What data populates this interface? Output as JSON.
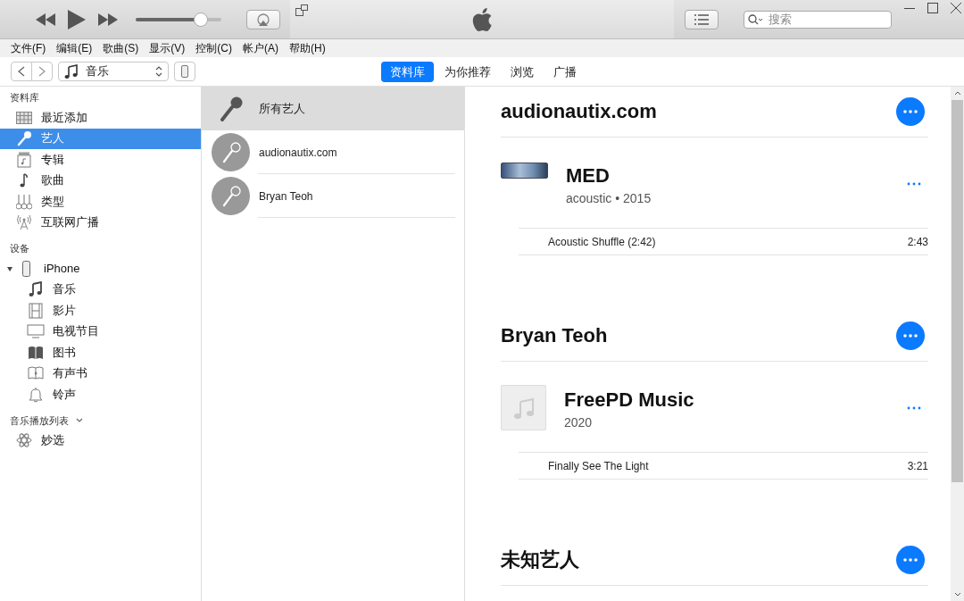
{
  "player": {
    "volume": {
      "level": 0.76
    }
  },
  "search": {
    "placeholder": "搜索"
  },
  "menu": [
    "文件(F)",
    "编辑(E)",
    "歌曲(S)",
    "显示(V)",
    "控制(C)",
    "帐户(A)",
    "帮助(H)"
  ],
  "media_picker": {
    "value": "音乐"
  },
  "tabs": [
    {
      "label": "资料库",
      "selected": true
    },
    {
      "label": "为你推荐",
      "selected": false
    },
    {
      "label": "浏览",
      "selected": false
    },
    {
      "label": "广播",
      "selected": false
    }
  ],
  "sidebar": {
    "library": {
      "heading": "资料库",
      "items": [
        {
          "label": "最近添加",
          "selected": false
        },
        {
          "label": "艺人",
          "selected": true
        },
        {
          "label": "专辑",
          "selected": false
        },
        {
          "label": "歌曲",
          "selected": false
        },
        {
          "label": "类型",
          "selected": false
        },
        {
          "label": "互联网广播",
          "selected": false
        }
      ]
    },
    "devices": {
      "heading": "设备",
      "items": [
        {
          "label": "iPhone",
          "expanded": true,
          "children": [
            {
              "label": "音乐",
              "selected": false
            },
            {
              "label": "影片",
              "selected": false
            },
            {
              "label": "电视节目",
              "selected": false
            },
            {
              "label": "图书",
              "selected": false
            },
            {
              "label": "有声书",
              "selected": false
            },
            {
              "label": "铃声",
              "selected": false
            }
          ]
        }
      ]
    },
    "playlists": {
      "heading": "音乐播放列表",
      "items": [
        {
          "label": "妙选",
          "selected": false
        }
      ]
    }
  },
  "artists": [
    {
      "kind": "all",
      "name": "所有艺人",
      "selected": true
    },
    {
      "kind": "artist",
      "name": "audionautix.com",
      "selected": false
    },
    {
      "kind": "artist",
      "name": "Bryan Teoh",
      "selected": false
    }
  ],
  "detail": [
    {
      "artist": "audionautix.com",
      "albums": [
        {
          "kind": "photo",
          "title": "MED",
          "subtitle": "acoustic • 2015",
          "tracks": [
            {
              "title": "Acoustic Shuffle (2:42)",
              "duration": "2:43"
            }
          ]
        }
      ]
    },
    {
      "artist": "Bryan Teoh",
      "albums": [
        {
          "kind": "placeholder",
          "title": "FreePD Music",
          "subtitle": "2020",
          "tracks": [
            {
              "title": "Finally See The Light",
              "duration": "3:21"
            }
          ]
        }
      ]
    },
    {
      "artist": "未知艺人"
    }
  ]
}
